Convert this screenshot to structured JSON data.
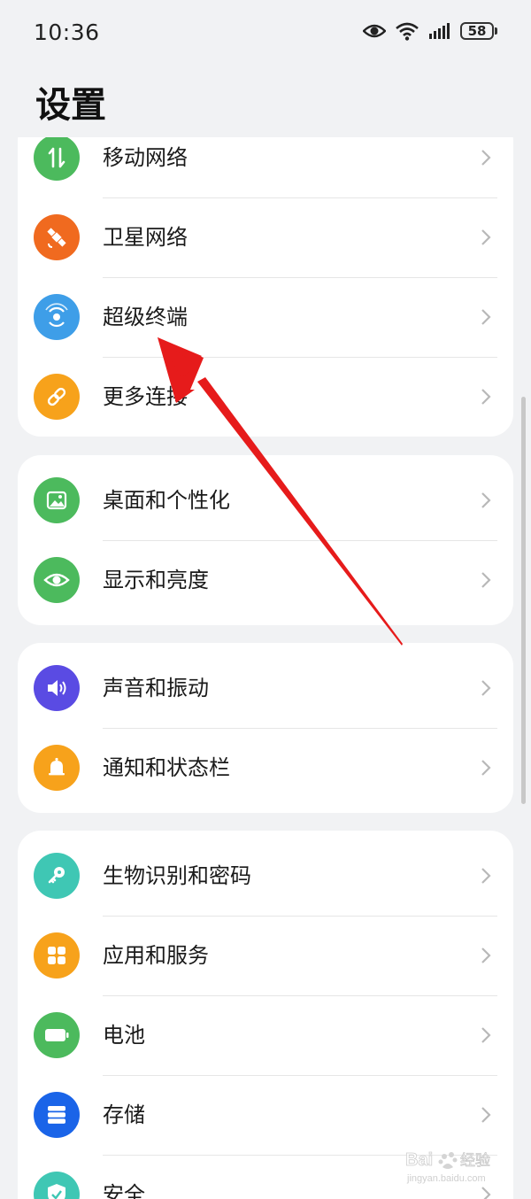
{
  "status_bar": {
    "time": "10:36",
    "battery": "58",
    "icons": [
      "eye-comfort-icon",
      "wifi-icon",
      "signal-icon",
      "battery-icon"
    ]
  },
  "page": {
    "title": "设置"
  },
  "groups": [
    {
      "items": [
        {
          "label": "移动网络",
          "icon": "mobile-data-icon",
          "color": "#4cba5d"
        },
        {
          "label": "卫星网络",
          "icon": "satellite-icon",
          "color": "#f06a1f"
        },
        {
          "label": "超级终端",
          "icon": "super-device-icon",
          "color": "#3e9ee8"
        },
        {
          "label": "更多连接",
          "icon": "link-icon",
          "color": "#f7a21b"
        }
      ]
    },
    {
      "items": [
        {
          "label": "桌面和个性化",
          "icon": "wallpaper-icon",
          "color": "#4cba5d"
        },
        {
          "label": "显示和亮度",
          "icon": "display-eye-icon",
          "color": "#4cba5d"
        }
      ]
    },
    {
      "items": [
        {
          "label": "声音和振动",
          "icon": "sound-icon",
          "color": "#5a4be3"
        },
        {
          "label": "通知和状态栏",
          "icon": "bell-icon",
          "color": "#f7a21b"
        }
      ]
    },
    {
      "items": [
        {
          "label": "生物识别和密码",
          "icon": "key-icon",
          "color": "#3fc7b4"
        },
        {
          "label": "应用和服务",
          "icon": "apps-icon",
          "color": "#f7a21b"
        },
        {
          "label": "电池",
          "icon": "battery-setting-icon",
          "color": "#4cba5d"
        },
        {
          "label": "存储",
          "icon": "storage-icon",
          "color": "#1a64e8"
        },
        {
          "label": "安全",
          "icon": "shield-icon",
          "color": "#3fc7b4"
        }
      ]
    }
  ],
  "annotation": {
    "arrow_color": "#e61b1b",
    "points_to": "超级终端"
  },
  "watermark": {
    "text": "Baidu 经验",
    "subtext": "jingyan.baidu.com"
  }
}
